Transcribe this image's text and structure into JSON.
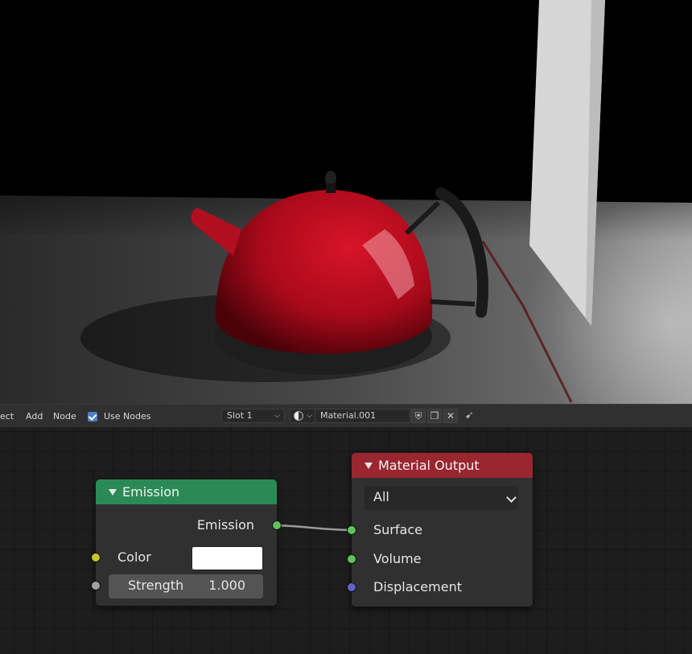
{
  "header": {
    "menu_select": "ect",
    "menu_add": "Add",
    "menu_node": "Node",
    "use_nodes_label": "Use Nodes",
    "use_nodes_checked": true,
    "slot_value": "Slot 1",
    "material_name": "Material.001"
  },
  "icons": [
    "checkbox-icon",
    "chevron-down-icon",
    "material-sphere-icon",
    "fake-user-shield-icon",
    "duplicate-icon",
    "close-icon",
    "pin-icon"
  ],
  "emission_node": {
    "title": "Emission",
    "output_label": "Emission",
    "color_label": "Color",
    "color_value": "#ffffff",
    "strength_label": "Strength",
    "strength_value": "1.000",
    "header_color": "#2a8a56"
  },
  "output_node": {
    "title": "Material Output",
    "target_value": "All",
    "surface_label": "Surface",
    "volume_label": "Volume",
    "displacement_label": "Displacement",
    "header_color": "#9a2630"
  },
  "socket_colors": {
    "shader": "#5fc35a",
    "color": "#c7c729",
    "value": "#a1a1a1",
    "vector": "#6363c7"
  }
}
